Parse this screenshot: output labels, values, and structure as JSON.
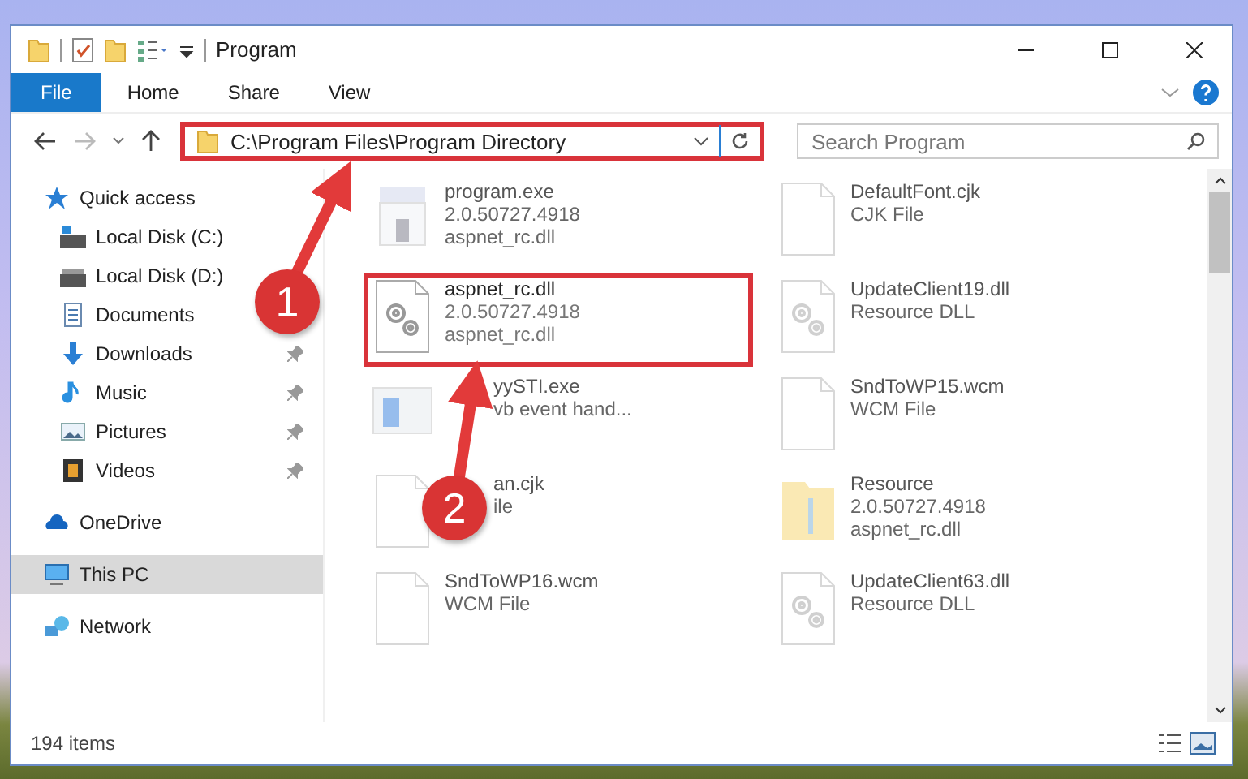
{
  "window": {
    "title": "Program"
  },
  "ribbon": {
    "tabs": [
      {
        "label": "File",
        "selected": true
      },
      {
        "label": "Home",
        "selected": false
      },
      {
        "label": "Share",
        "selected": false
      },
      {
        "label": "View",
        "selected": false
      }
    ]
  },
  "address": {
    "path": "C:\\Program Files\\Program Directory",
    "highlighted": true
  },
  "search": {
    "placeholder": "Search Program"
  },
  "sidebar": {
    "items": [
      {
        "label": "Quick access",
        "kind": "star",
        "selected": false,
        "pinned": false,
        "children": [
          {
            "label": "Local Disk (C:)",
            "kind": "disk-c",
            "selected": false,
            "pinned": false
          },
          {
            "label": "Local Disk (D:)",
            "kind": "disk",
            "selected": false,
            "pinned": false
          },
          {
            "label": "Documents",
            "kind": "docs",
            "selected": false,
            "pinned": false
          },
          {
            "label": "Downloads",
            "kind": "down",
            "selected": false,
            "pinned": true
          },
          {
            "label": "Music",
            "kind": "music",
            "selected": false,
            "pinned": true
          },
          {
            "label": "Pictures",
            "kind": "pics",
            "selected": false,
            "pinned": true
          },
          {
            "label": "Videos",
            "kind": "video",
            "selected": false,
            "pinned": true
          }
        ]
      },
      {
        "label": "OneDrive",
        "kind": "cloud",
        "selected": false,
        "pinned": false
      },
      {
        "label": "This PC",
        "kind": "pc",
        "selected": true,
        "pinned": false
      },
      {
        "label": "Network",
        "kind": "net",
        "selected": false,
        "pinned": false
      }
    ]
  },
  "files": [
    {
      "name": "program.exe",
      "lines": [
        "2.0.50727.4918",
        "aspnet_rc.dll"
      ],
      "kind": "exe",
      "highlighted": false,
      "blurred": true,
      "covered": false
    },
    {
      "name": "DefaultFont.cjk",
      "lines": [
        "CJK File"
      ],
      "kind": "doc",
      "highlighted": false,
      "blurred": true,
      "covered": false
    },
    {
      "name": "aspnet_rc.dll",
      "lines": [
        "2.0.50727.4918",
        "aspnet_rc.dll"
      ],
      "kind": "gear",
      "highlighted": true,
      "blurred": false,
      "covered": false
    },
    {
      "name": "UpdateClient19.dll",
      "lines": [
        "Resource DLL"
      ],
      "kind": "gear",
      "highlighted": false,
      "blurred": true,
      "covered": false
    },
    {
      "name": "yySTI.exe",
      "lines": [
        "vb event hand..."
      ],
      "kind": "app",
      "highlighted": false,
      "blurred": true,
      "covered": true
    },
    {
      "name": "SndToWP15.wcm",
      "lines": [
        "WCM File"
      ],
      "kind": "doc",
      "highlighted": false,
      "blurred": true,
      "covered": false
    },
    {
      "name": "an.cjk",
      "lines": [
        "ile"
      ],
      "kind": "doc",
      "highlighted": false,
      "blurred": true,
      "covered": true
    },
    {
      "name": "Resource",
      "lines": [
        "2.0.50727.4918",
        "aspnet_rc.dll"
      ],
      "kind": "folder",
      "highlighted": false,
      "blurred": true,
      "covered": false
    },
    {
      "name": "SndToWP16.wcm",
      "lines": [
        "WCM File"
      ],
      "kind": "doc",
      "highlighted": false,
      "blurred": true,
      "covered": false
    },
    {
      "name": "UpdateClient63.dll",
      "lines": [
        "Resource DLL"
      ],
      "kind": "gear",
      "highlighted": false,
      "blurred": true,
      "covered": false
    }
  ],
  "annotations": [
    {
      "label": "1"
    },
    {
      "label": "2"
    }
  ],
  "status_bar": {
    "count": "194 items"
  }
}
